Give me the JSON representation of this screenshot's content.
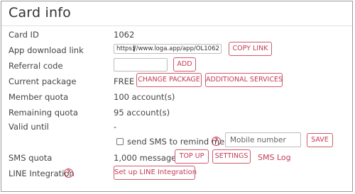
{
  "title": "Card info",
  "rows": {
    "card_id": {
      "label": "Card ID",
      "value": "1062"
    },
    "app_link": {
      "label": "App download link",
      "url": "https://www.loga.app/app/OL1062",
      "copy_label": "COPY LINK"
    },
    "referral": {
      "label": "Referral code",
      "value": "",
      "add_label": "ADD"
    },
    "package": {
      "label": "Current package",
      "value": "FREE",
      "change_label": "CHANGE PACKAGE",
      "services_label": "ADDITIONAL SERVICES"
    },
    "member_quota": {
      "label": "Member quota",
      "value": "100 account(s)"
    },
    "remaining_quota": {
      "label": "Remaining quota",
      "value": "95 account(s)"
    },
    "valid_until": {
      "label": "Valid until",
      "value": "-"
    },
    "sms_remind": {
      "checkbox_label": "send SMS to remind me",
      "checked": false,
      "mobile_placeholder": "Mobile number",
      "save_label": "SAVE"
    },
    "sms_quota": {
      "label": "SMS quota",
      "value": "1,000 message(s)",
      "topup_label": "TOP UP",
      "settings_label": "SETTINGS",
      "log_label": "SMS Log"
    },
    "line": {
      "label": "LINE Integration",
      "setup_label": "Set up LINE Integration"
    }
  },
  "help_symbol": "?",
  "cursor_symbol": "I",
  "accent_color": "#c33b55"
}
